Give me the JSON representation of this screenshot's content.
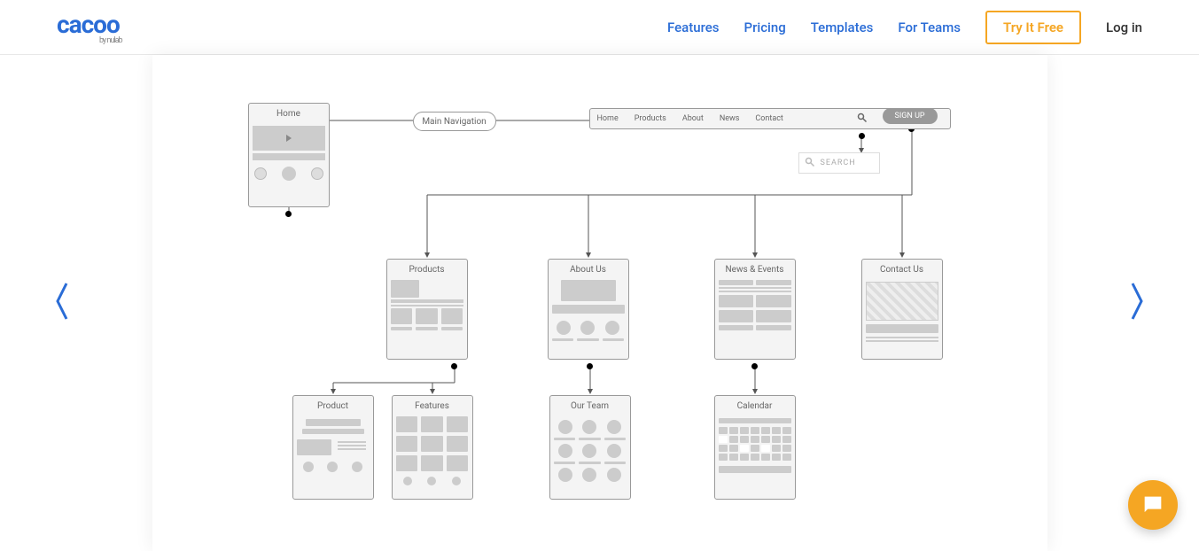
{
  "header": {
    "logo": "cacoo",
    "logo_sub": "by nulab",
    "nav": {
      "features": "Features",
      "pricing": "Pricing",
      "templates": "Templates",
      "for_teams": "For Teams",
      "cta": "Try It Free",
      "login": "Log in"
    }
  },
  "diagram": {
    "home": "Home",
    "main_nav": "Main Navigation",
    "navbar": {
      "home": "Home",
      "products": "Products",
      "about": "About",
      "news": "News",
      "contact": "Contact"
    },
    "signup": "SIGN UP",
    "search": "SEARCH",
    "cards": {
      "products": "Products",
      "about_us": "About Us",
      "news_events": "News & Events",
      "contact_us": "Contact Us",
      "product": "Product",
      "features": "Features",
      "our_team": "Our Team",
      "calendar": "Calendar"
    }
  }
}
